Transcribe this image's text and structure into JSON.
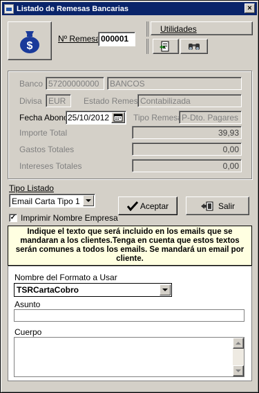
{
  "window": {
    "title": "Listado de Remesas Bancarias"
  },
  "header": {
    "remesa_label": "Nº Remesa",
    "remesa_value": "000001",
    "utilidades_label": "Utilidades"
  },
  "details": {
    "banco_label": "Banco",
    "banco_code": "57200000000",
    "banco_name": "BANCOS",
    "divisa_label": "Divisa",
    "divisa_value": "EUR",
    "estado_label": "Estado Remesa",
    "estado_value": "Contabilizada",
    "fecha_label": "Fecha Abono",
    "fecha_value": "25/10/2012",
    "tipo_label": "Tipo Remesa",
    "tipo_value": "P-Dto. Pagares",
    "importe_label": "Importe Total",
    "importe_value": "39,93",
    "gastos_label": "Gastos Totales",
    "gastos_value": "0,00",
    "intereses_label": "Intereses Totales",
    "intereses_value": "0,00"
  },
  "listing": {
    "tipo_listado_label": "Tipo Listado",
    "tipo_listado_value": "Email Carta Tipo 1",
    "imprimir_label": "Imprimir Nombre Empresa",
    "imprimir_checked": true,
    "aceptar_label": "Aceptar",
    "salir_label": "Salir"
  },
  "email": {
    "info_text": "Indique el texto que será incluido en los emails que se mandaran a los clientes.Tenga en cuenta que estos textos serán comunes a todos los emails. Se mandará un email por cliente.",
    "formato_label": "Nombre del Formato a Usar",
    "formato_value": "TSRCartaCobro",
    "asunto_label": "Asunto",
    "asunto_value": "",
    "cuerpo_label": "Cuerpo",
    "cuerpo_value": ""
  },
  "colors": {
    "titlebar": "#0a246a",
    "info_background": "#ffffe1",
    "face": "#d4d0c8"
  }
}
